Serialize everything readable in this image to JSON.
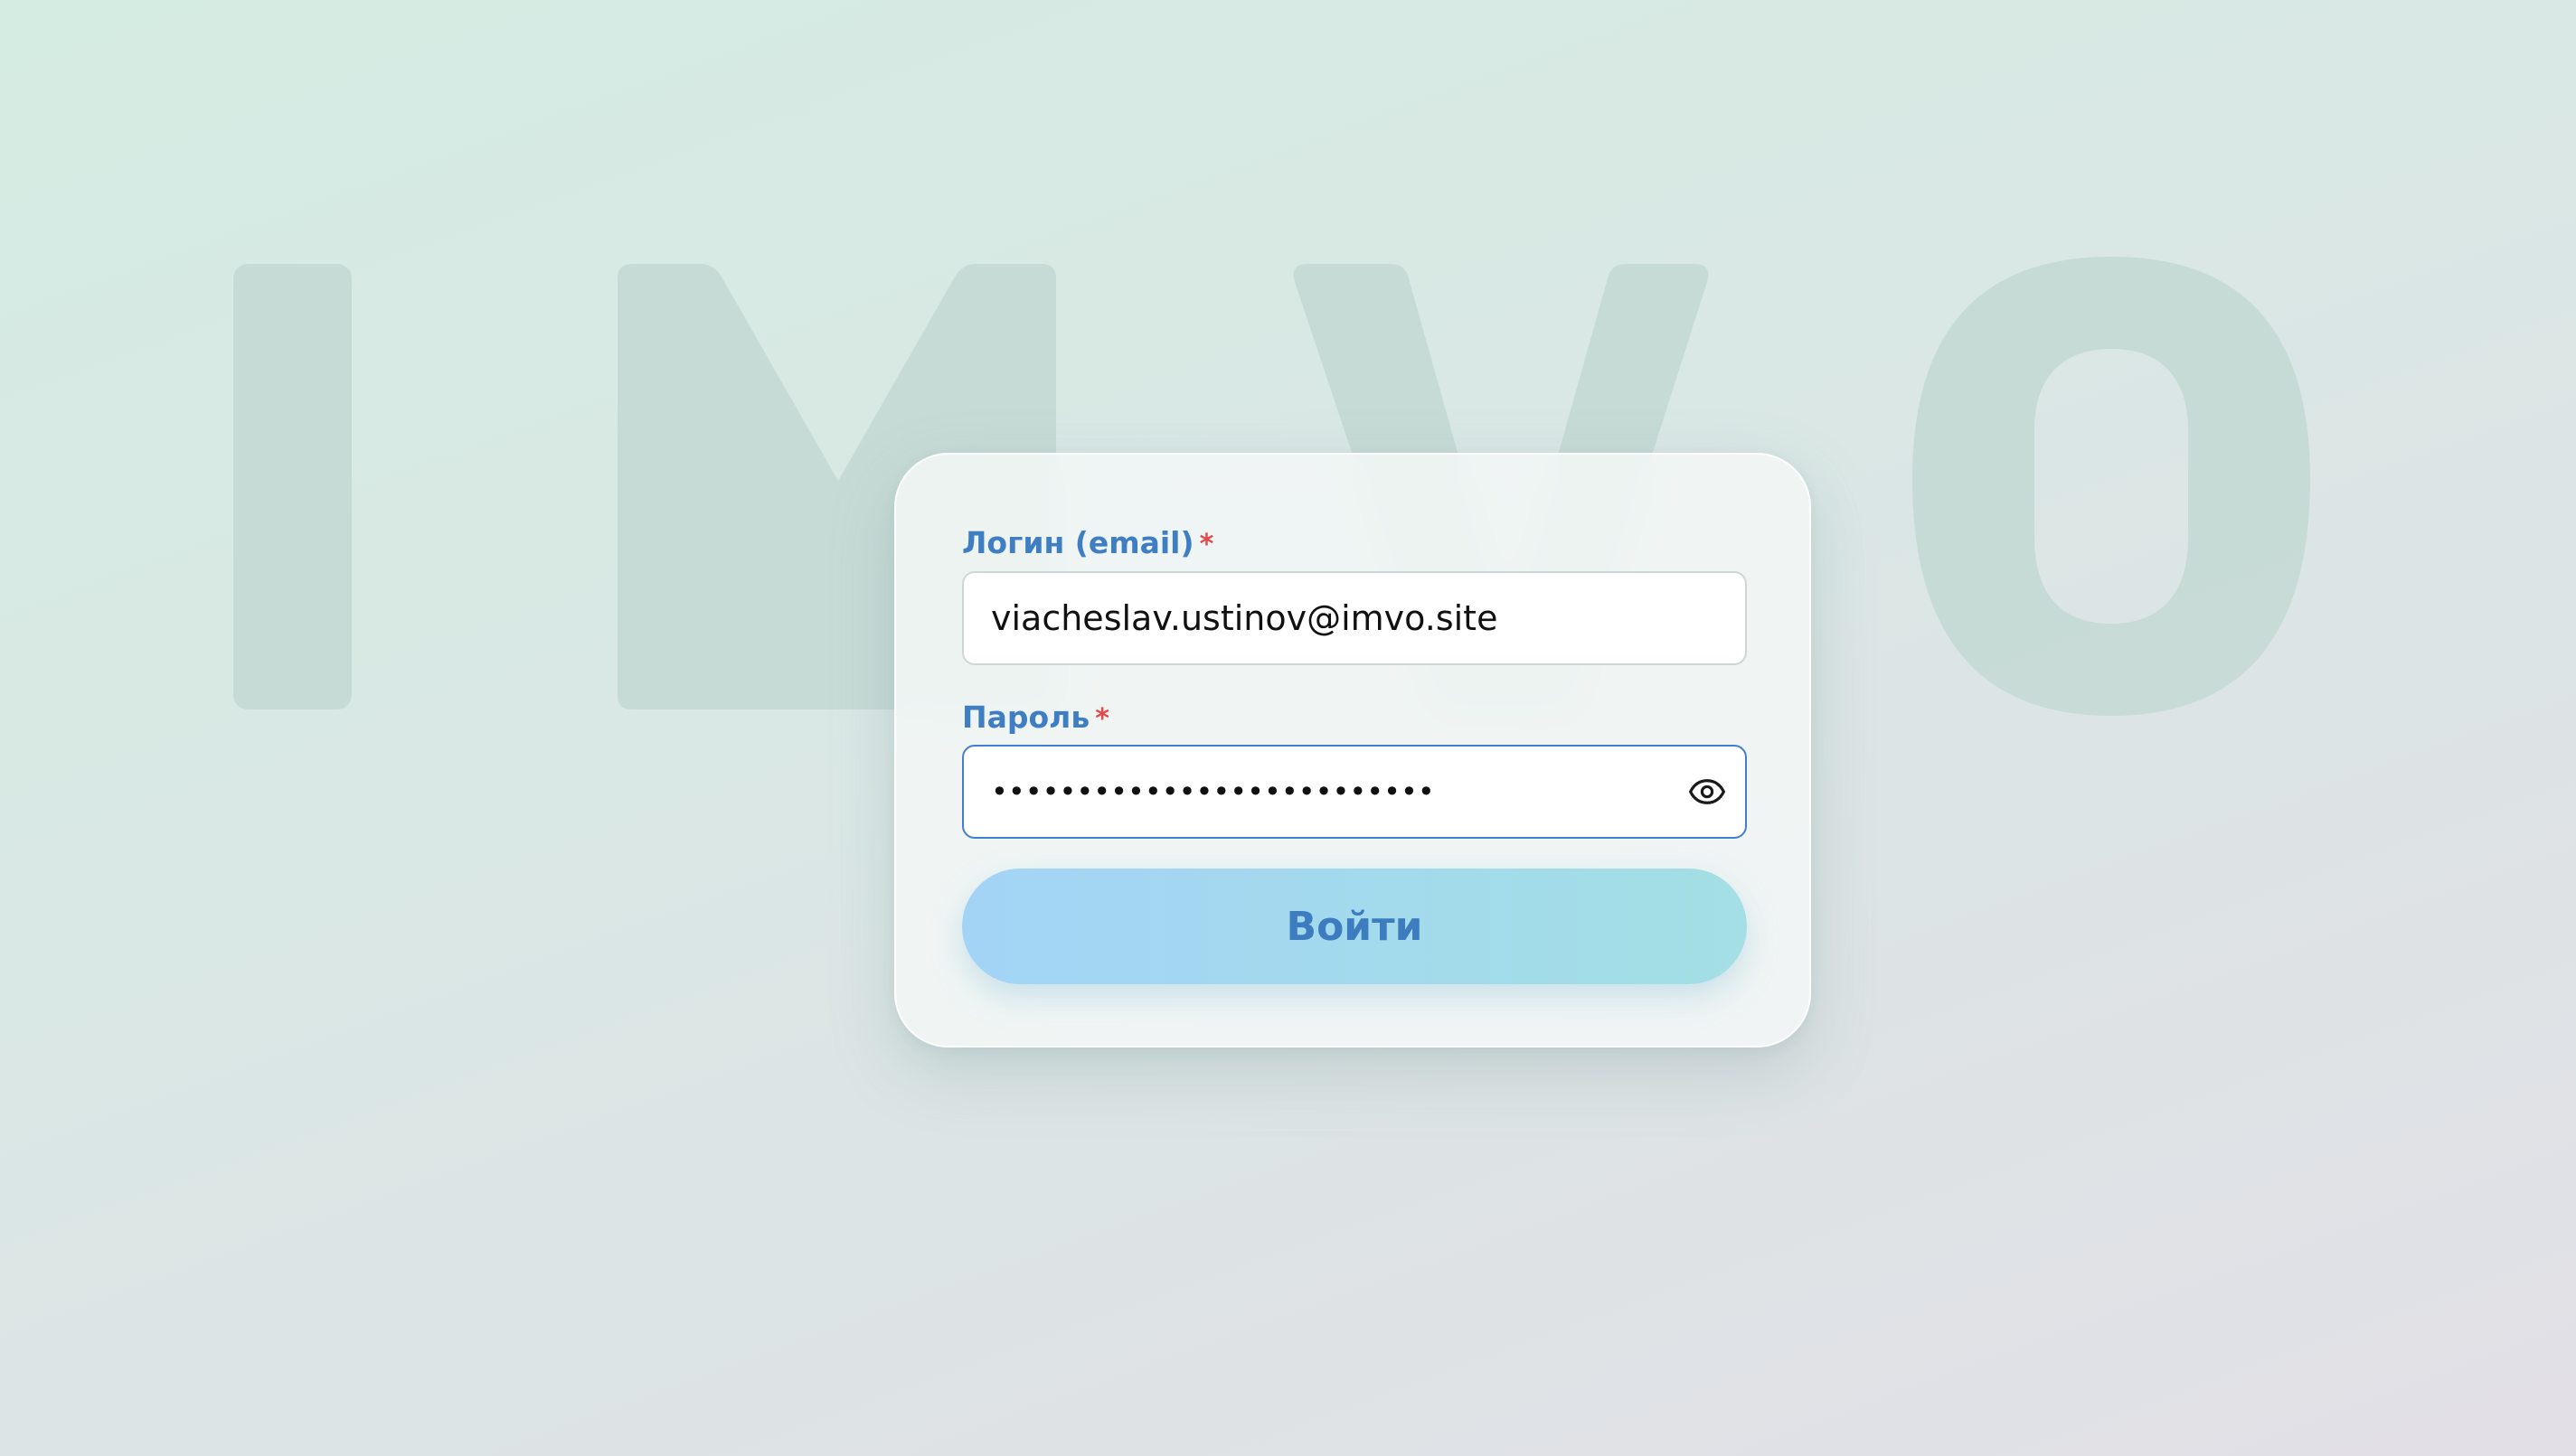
{
  "background": {
    "logo_text": "IMVO",
    "logo_color": "#c7dbd6"
  },
  "form": {
    "email": {
      "label": "Логин (email)",
      "required_mark": "*",
      "value": "viacheslav.ustinov@imvo.site"
    },
    "password": {
      "label": "Пароль",
      "required_mark": "*",
      "masked_value": "••••••••••••••••••••••••••",
      "toggle_icon": "eye-icon"
    },
    "submit_label": "Войти"
  },
  "colors": {
    "label": "#3f7ec2",
    "required": "#e04a4a",
    "focus_border": "#3f80d0",
    "button_gradient_start": "#a3d4f6",
    "button_gradient_end": "#a3dfe4",
    "button_text": "#3d7cbf"
  }
}
